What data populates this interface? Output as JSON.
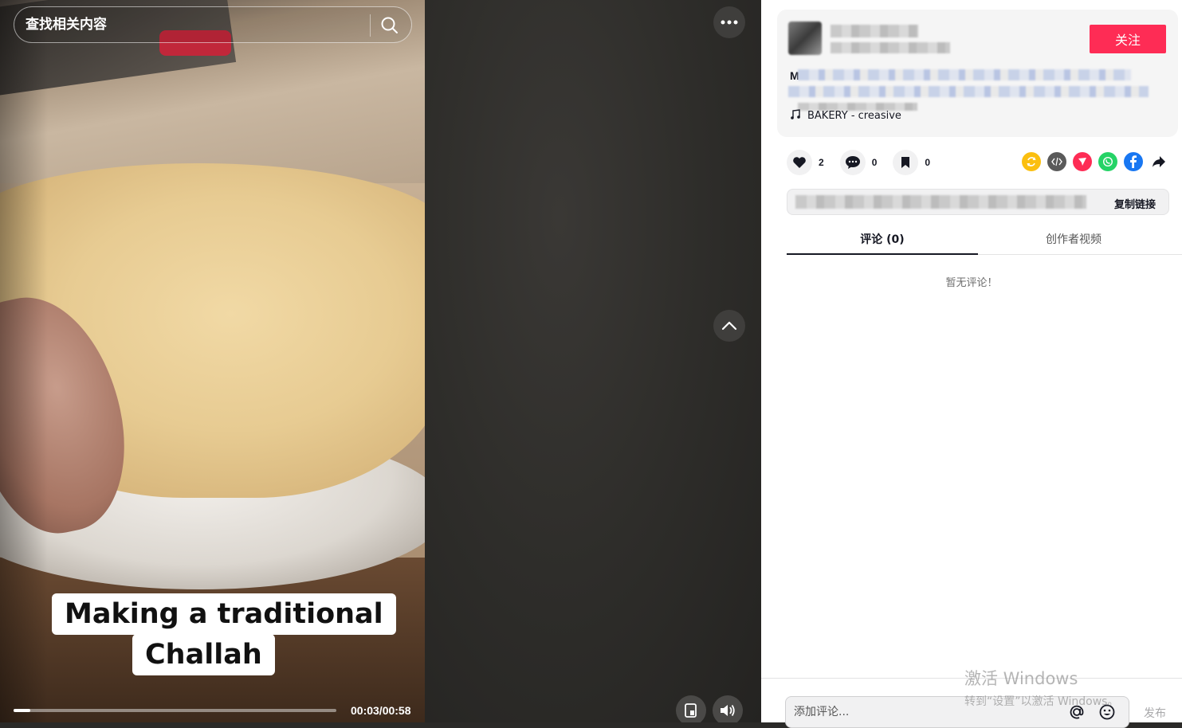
{
  "search": {
    "placeholder": "查找相关内容"
  },
  "video": {
    "caption_line1": "Making a traditional",
    "caption_line2": "Challah",
    "time_display": "00:03/00:58",
    "progress_fraction": 0.052
  },
  "panel": {
    "description_start": "M",
    "music": "BAKERY - creasive",
    "follow_label": "关注",
    "likes": "2",
    "comments": "0",
    "saves": "0",
    "copy_link_label": "复制链接",
    "tabs": [
      {
        "label": "评论 (0)"
      },
      {
        "label": "创作者视频"
      }
    ],
    "empty_comments": "暂无评论！",
    "comment_placeholder": "添加评论...",
    "post_label": "发布"
  },
  "watermark": {
    "line1": "激活 Windows",
    "line2": "转到“设置”以激活 Windows。"
  },
  "colors": {
    "accent": "#fe2c55",
    "share_repost": "#fbbf0f",
    "share_embed": "#5a5a5a",
    "share_send": "#fe2c55",
    "share_whatsapp": "#25d366",
    "share_facebook": "#1877f2"
  }
}
